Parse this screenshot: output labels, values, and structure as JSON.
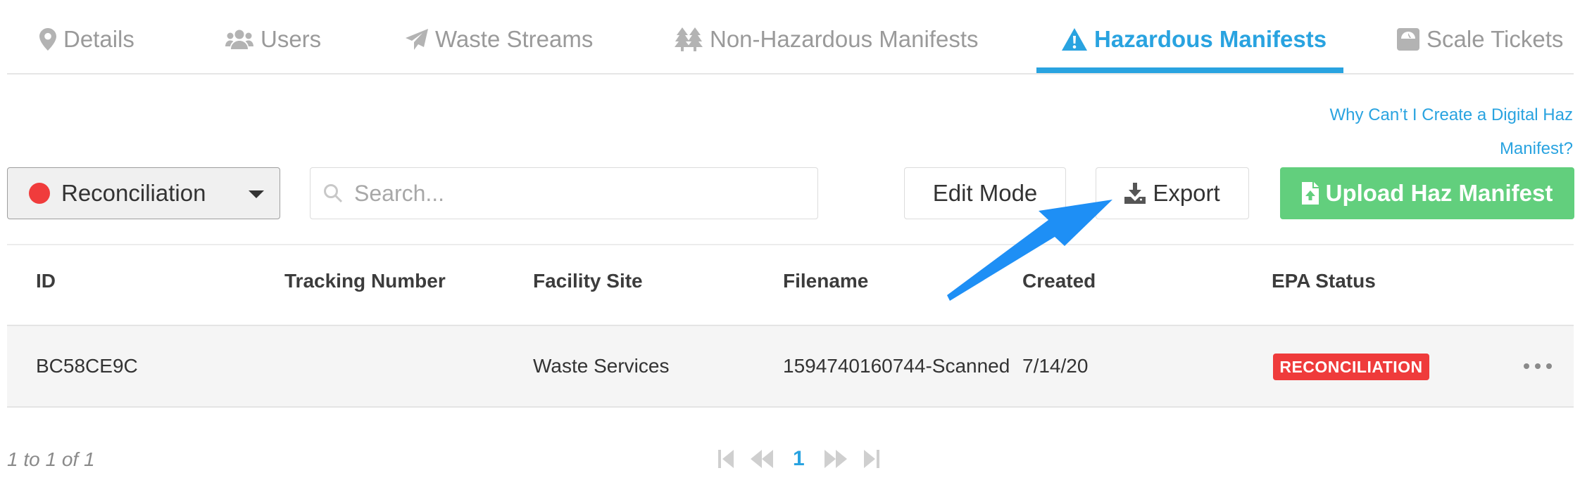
{
  "tabs": [
    {
      "label": "Details",
      "icon": "map-pin-icon"
    },
    {
      "label": "Users",
      "icon": "users-icon"
    },
    {
      "label": "Waste Streams",
      "icon": "paper-plane-icon"
    },
    {
      "label": "Non-Hazardous Manifests",
      "icon": "trees-icon"
    },
    {
      "label": "Hazardous Manifests",
      "icon": "warning-icon",
      "active": true
    },
    {
      "label": "Scale Tickets",
      "icon": "scale-icon"
    }
  ],
  "help_link": "Why Can’t I Create a Digital Haz Manifest?",
  "toolbar": {
    "status_filter": "Reconciliation",
    "status_color": "#f03c3c",
    "search_placeholder": "Search...",
    "search_value": "",
    "edit_mode_label": "Edit Mode",
    "export_label": "Export",
    "upload_label": "Upload Haz Manifest"
  },
  "table": {
    "columns": [
      "ID",
      "Tracking Number",
      "Facility Site",
      "Filename",
      "Created",
      "EPA Status"
    ],
    "rows": [
      {
        "id": "BC58CE9C",
        "tracking_number": "",
        "facility_site": "Waste Services",
        "filename": "1594740160744-Scanned",
        "created": "7/14/20",
        "epa_status": "RECONCILIATION"
      }
    ]
  },
  "pagination": {
    "info": "1 to 1 of 1",
    "current_page": "1"
  },
  "colors": {
    "accent": "#29a3e0",
    "success": "#62cf7d",
    "danger": "#ef3b3b",
    "annotation_arrow": "#1e8ff5"
  }
}
